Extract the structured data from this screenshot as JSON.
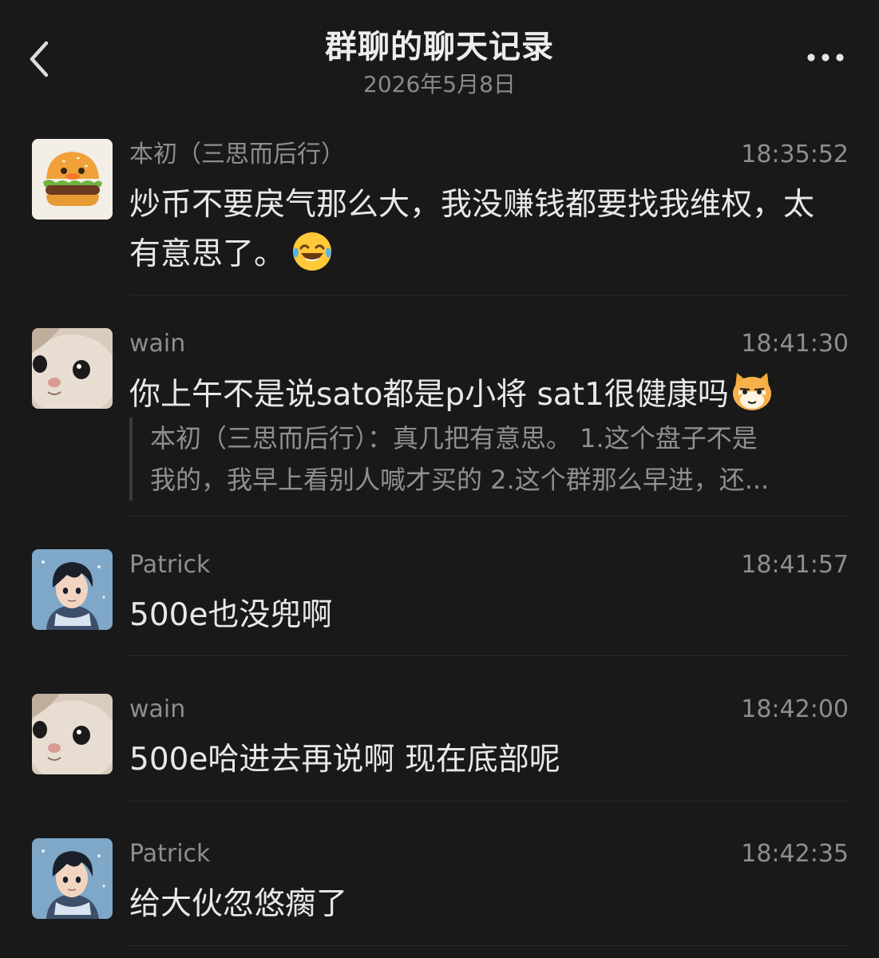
{
  "header": {
    "title": "群聊的聊天记录",
    "date": "2026年5月8日",
    "back_icon": "chevron-left-icon",
    "more_icon": "more-horizontal-icon"
  },
  "messages": [
    {
      "sender": "本初（三思而后行）",
      "time": "18:35:52",
      "text": "炒币不要戾气那么大，我没赚钱都要找我维权，太有意思了。",
      "emoji": "tears-of-joy-emoji",
      "avatar": "burger-avatar"
    },
    {
      "sender": "wain",
      "time": "18:41:30",
      "text": "你上午不是说sato都是p小将  sat1很健康吗",
      "emoji": "sly-cat-emoji",
      "avatar": "cat-avatar",
      "quote": {
        "line1": "本初（三思而后行）：真几把有意思。 1.这个盘子不是",
        "line2": "我的，我早上看别人喊才买的 2.这个群那么早进，还..."
      }
    },
    {
      "sender": "Patrick",
      "time": "18:41:57",
      "text": "500e也没兜啊",
      "avatar": "anime-boy-avatar"
    },
    {
      "sender": "wain",
      "time": "18:42:00",
      "text": "500e哈进去再说啊 现在底部呢",
      "avatar": "cat-avatar"
    },
    {
      "sender": "Patrick",
      "time": "18:42:35",
      "text": "给大伙忽悠瘸了",
      "avatar": "anime-boy-avatar"
    }
  ],
  "colors": {
    "background": "#191919",
    "text": "#e8e8e8",
    "muted": "#8e8e8e",
    "divider": "#2c2c2c"
  }
}
